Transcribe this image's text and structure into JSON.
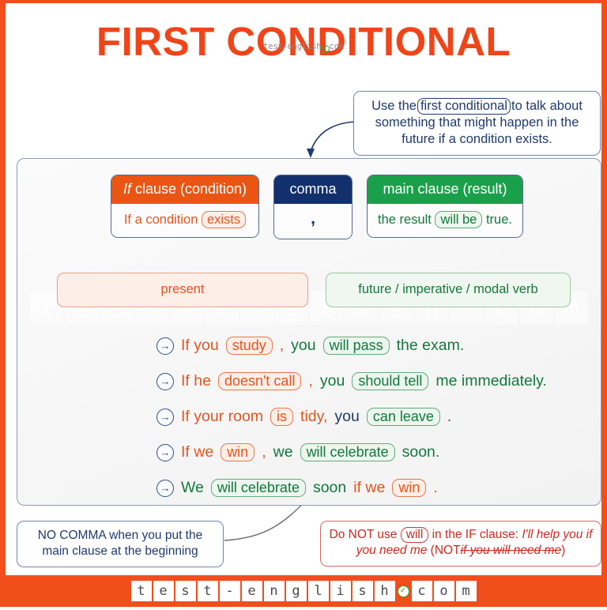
{
  "title": "FIRST CONDITIONAL",
  "title_watermark": {
    "left": "test-english",
    "right": "com",
    "badge_icon": "check-badge-icon"
  },
  "colors": {
    "orange": "#f04e1a",
    "orange_text": "#e2561f",
    "navy": "#12306b",
    "green": "#1aa04a",
    "green_text": "#13783c",
    "red": "#cc2a20"
  },
  "callout_top": {
    "part1": "Use the",
    "highlight": "first conditional",
    "part2": "to talk about something that might happen in the future if a condition exists."
  },
  "structure": {
    "if_clause": {
      "header_italic": "If",
      "header_rest": " clause (condition)",
      "body_pre": "If a condition",
      "body_pill": "exists"
    },
    "comma": {
      "header": "comma",
      "body": ","
    },
    "main_clause": {
      "header": "main clause (result)",
      "body_pre": "the result",
      "body_pill": "will be",
      "body_post": "true."
    }
  },
  "tenses": {
    "left": "present",
    "right": "future / imperative / modal verb"
  },
  "examples": [
    {
      "icon": "circle-arrow-right-icon",
      "segments": [
        {
          "text": "If you",
          "style": "or"
        },
        {
          "text": "study",
          "style": "pill-or"
        },
        {
          "text": ",",
          "style": "or"
        },
        {
          "text": "you",
          "style": "gr"
        },
        {
          "text": "will pass",
          "style": "pill-gr"
        },
        {
          "text": "the exam.",
          "style": "gr"
        }
      ]
    },
    {
      "icon": "circle-arrow-right-icon",
      "segments": [
        {
          "text": "If he",
          "style": "or"
        },
        {
          "text": "doesn't call",
          "style": "pill-or"
        },
        {
          "text": ",",
          "style": "or"
        },
        {
          "text": "you",
          "style": "gr"
        },
        {
          "text": "should tell",
          "style": "pill-gr"
        },
        {
          "text": "me immediately.",
          "style": "gr"
        }
      ]
    },
    {
      "icon": "circle-arrow-right-icon",
      "segments": [
        {
          "text": "If your room",
          "style": "or"
        },
        {
          "text": "is",
          "style": "pill-or"
        },
        {
          "text": "tidy,",
          "style": "or"
        },
        {
          "text": "you",
          "style": "nv"
        },
        {
          "text": "can leave",
          "style": "pill-gr"
        },
        {
          "text": ".",
          "style": "gr"
        }
      ]
    },
    {
      "icon": "circle-arrow-right-icon",
      "segments": [
        {
          "text": "If we",
          "style": "or"
        },
        {
          "text": "win",
          "style": "pill-or"
        },
        {
          "text": ",",
          "style": "or"
        },
        {
          "text": "we",
          "style": "gr"
        },
        {
          "text": "will celebrate",
          "style": "pill-gr"
        },
        {
          "text": "soon.",
          "style": "gr"
        }
      ]
    },
    {
      "icon": "circle-arrow-right-icon",
      "segments": [
        {
          "text": "We",
          "style": "gr"
        },
        {
          "text": "will celebrate",
          "style": "pill-gr"
        },
        {
          "text": "soon",
          "style": "gr"
        },
        {
          "text": "if we",
          "style": "or"
        },
        {
          "text": "win",
          "style": "pill-or"
        },
        {
          "text": ".",
          "style": "or"
        }
      ]
    }
  ],
  "note_left": "NO COMMA when you put the main clause at the beginning",
  "note_right": {
    "part1": "Do NOT use",
    "pill": "will",
    "part2": "in the IF clause:",
    "italic1": "I'll help you if you need me",
    "part3": "(NOT",
    "strike": "if you will need me",
    "part4": ")"
  },
  "watermark_letters": [
    "t",
    "e",
    "s",
    "t",
    "-",
    "e",
    "n",
    "g",
    "l",
    "i",
    "s",
    "h",
    "",
    "c",
    "o",
    "m"
  ],
  "footer": {
    "letters": [
      "t",
      "e",
      "s",
      "t",
      "-",
      "e",
      "n",
      "g",
      "l",
      "i",
      "s",
      "h"
    ],
    "tail": [
      "c",
      "o",
      "m"
    ],
    "badge_icon": "check-badge-icon"
  }
}
